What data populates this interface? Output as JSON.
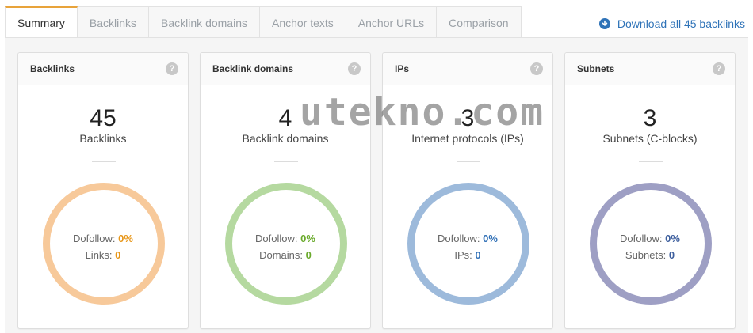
{
  "tabs": [
    {
      "label": "Summary",
      "active": true
    },
    {
      "label": "Backlinks",
      "active": false
    },
    {
      "label": "Backlink domains",
      "active": false
    },
    {
      "label": "Anchor texts",
      "active": false
    },
    {
      "label": "Anchor URLs",
      "active": false
    },
    {
      "label": "Comparison",
      "active": false
    }
  ],
  "download": {
    "label": "Download all 45 backlinks",
    "icon": "download-circle-icon",
    "color": "#2f73b8"
  },
  "help_glyph": "?",
  "cards": [
    {
      "title": "Backlinks",
      "value": "45",
      "sublabel": "Backlinks",
      "ring_color": "#f7c99a",
      "accent": "#e8971a",
      "line1_label": "Dofollow:",
      "line1_value": "0%",
      "line2_label": "Links:",
      "line2_value": "0"
    },
    {
      "title": "Backlink domains",
      "value": "4",
      "sublabel": "Backlink domains",
      "ring_color": "#b5d9a0",
      "accent": "#6aaa2c",
      "line1_label": "Dofollow:",
      "line1_value": "0%",
      "line2_label": "Domains:",
      "line2_value": "0"
    },
    {
      "title": "IPs",
      "value": "3",
      "sublabel": "Internet protocols (IPs)",
      "ring_color": "#9dbadb",
      "accent": "#2f6fb6",
      "line1_label": "Dofollow:",
      "line1_value": "0%",
      "line2_label": "IPs:",
      "line2_value": "0"
    },
    {
      "title": "Subnets",
      "value": "3",
      "sublabel": "Subnets (C-blocks)",
      "ring_color": "#9e9fc4",
      "accent": "#3e5f9e",
      "line1_label": "Dofollow:",
      "line1_value": "0%",
      "line2_label": "Subnets:",
      "line2_value": "0"
    }
  ],
  "watermark": "utekno.com"
}
